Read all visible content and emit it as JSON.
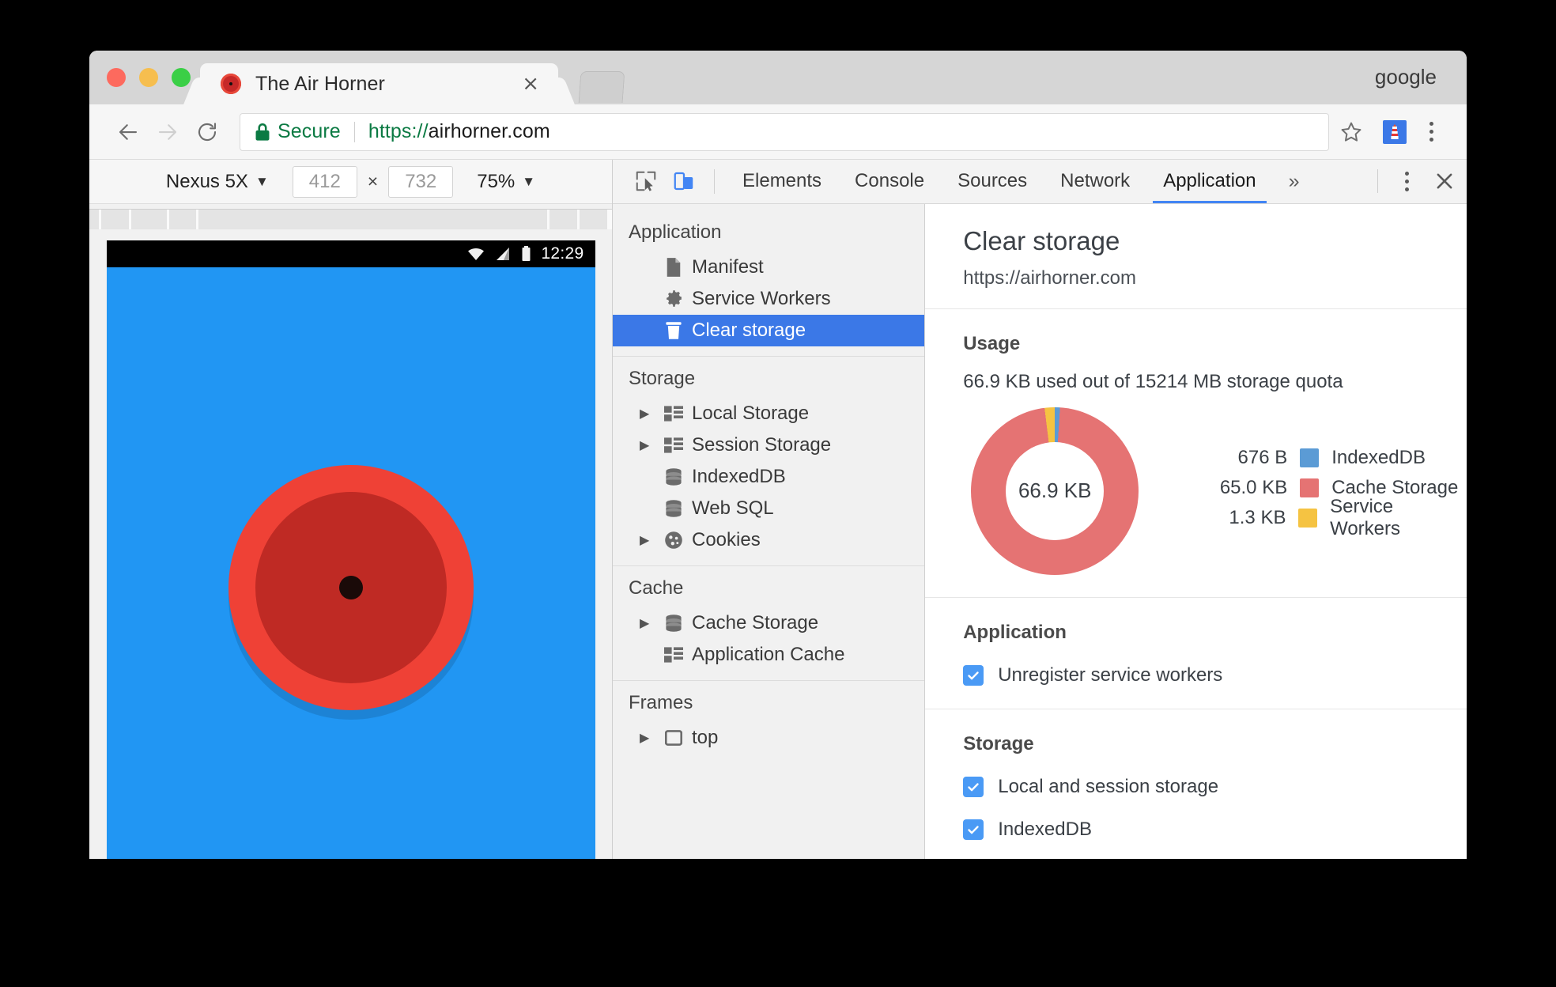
{
  "window": {
    "profile_label": "google",
    "traffic_lights": [
      "close",
      "minimize",
      "maximize"
    ],
    "tab": {
      "title": "The Air Horner",
      "close_label": "×",
      "favicon_name": "airhorn-favicon"
    },
    "newtab_label": "+"
  },
  "toolbar": {
    "back_label": "Back",
    "forward_label": "Forward",
    "reload_label": "Reload",
    "security_label": "Secure",
    "url_scheme": "https://",
    "url_host": "airhorner.com",
    "url_full": "https://airhorner.com",
    "bookmark_label": "Bookmark",
    "extension_label": "Lighthouse",
    "menu_label": "Customize and control Google Chrome"
  },
  "device_toolbar": {
    "device": "Nexus 5X",
    "device_caret": "▼",
    "width": "412",
    "height": "732",
    "times": "×",
    "zoom": "75%",
    "zoom_caret": "▼"
  },
  "device_preview": {
    "status_bar": {
      "time": "12:29",
      "icons": [
        "wifi-icon",
        "cellular-signal-icon",
        "battery-icon"
      ]
    },
    "page_bg": "#2196f3",
    "horn": {
      "outer_color": "#ef4136",
      "inner_color": "#bf2a24",
      "nub_color": "#1a0a08"
    }
  },
  "devtools": {
    "inspect_icon": "inspect-element-icon",
    "device_toggle_icon": "toggle-device-toolbar-icon",
    "tabs": [
      {
        "label": "Elements",
        "active": false
      },
      {
        "label": "Console",
        "active": false
      },
      {
        "label": "Sources",
        "active": false
      },
      {
        "label": "Network",
        "active": false
      },
      {
        "label": "Application",
        "active": true
      }
    ],
    "more_tabs_label": "»",
    "menu_label": "More options",
    "close_label": "×",
    "sidebar": [
      {
        "title": "Application",
        "items": [
          {
            "label": "Manifest",
            "icon": "document-icon",
            "twisty": false,
            "selected": false
          },
          {
            "label": "Service Workers",
            "icon": "gear-icon",
            "twisty": false,
            "selected": false
          },
          {
            "label": "Clear storage",
            "icon": "trash-icon",
            "twisty": false,
            "selected": true
          }
        ]
      },
      {
        "title": "Storage",
        "items": [
          {
            "label": "Local Storage",
            "icon": "table-icon",
            "twisty": true,
            "selected": false
          },
          {
            "label": "Session Storage",
            "icon": "table-icon",
            "twisty": true,
            "selected": false
          },
          {
            "label": "IndexedDB",
            "icon": "database-icon",
            "twisty": false,
            "selected": false
          },
          {
            "label": "Web SQL",
            "icon": "database-icon",
            "twisty": false,
            "selected": false
          },
          {
            "label": "Cookies",
            "icon": "cookie-icon",
            "twisty": true,
            "selected": false
          }
        ]
      },
      {
        "title": "Cache",
        "items": [
          {
            "label": "Cache Storage",
            "icon": "database-icon",
            "twisty": true,
            "selected": false
          },
          {
            "label": "Application Cache",
            "icon": "table-icon",
            "twisty": false,
            "selected": false
          }
        ]
      },
      {
        "title": "Frames",
        "items": [
          {
            "label": "top",
            "icon": "frame-icon",
            "twisty": true,
            "selected": false
          }
        ]
      }
    ],
    "panel": {
      "title": "Clear storage",
      "origin": "https://airhorner.com",
      "usage": {
        "heading": "Usage",
        "summary": "66.9 KB used out of 15214 MB storage quota",
        "center_label": "66.9 KB"
      },
      "application_section": {
        "heading": "Application",
        "checkboxes": [
          {
            "label": "Unregister service workers",
            "checked": true
          }
        ]
      },
      "storage_section": {
        "heading": "Storage",
        "checkboxes": [
          {
            "label": "Local and session storage",
            "checked": true
          },
          {
            "label": "IndexedDB",
            "checked": true
          }
        ]
      }
    }
  },
  "chart_data": {
    "type": "pie",
    "title": "Usage",
    "categories": [
      "IndexedDB",
      "Cache Storage",
      "Service Workers"
    ],
    "values": [
      0.676,
      65.0,
      1.3
    ],
    "value_labels": [
      "676 B",
      "65.0 KB",
      "1.3 KB"
    ],
    "colors": [
      "#5b9bd5",
      "#e57373",
      "#f5c342"
    ],
    "center_label": "66.9 KB",
    "total": "66.9 KB",
    "quota": "15214 MB",
    "legend_position": "right",
    "grid": false
  },
  "colors": {
    "accent": "#4285f4",
    "selection": "#3b78e7",
    "secure_green": "#0b7a43",
    "cache_storage": "#e57373",
    "indexeddb": "#5b9bd5",
    "service_workers": "#f5c342",
    "checkbox": "#4a9af5"
  }
}
